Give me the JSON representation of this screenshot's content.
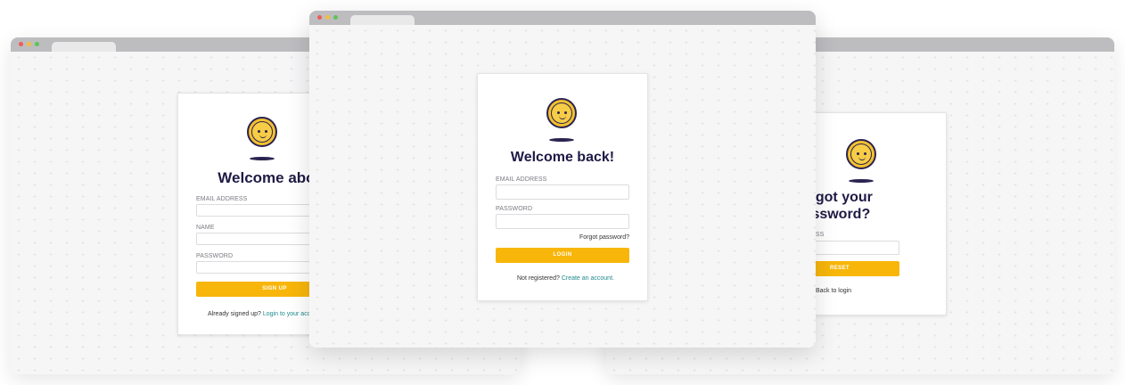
{
  "signup": {
    "title": "Welcome aboard!",
    "email_label": "EMAIL ADDRESS",
    "name_label": "NAME",
    "password_label": "PASSWORD",
    "button": "SIGN UP",
    "footer_text": "Already signed up?",
    "footer_link": "Login to your account."
  },
  "login": {
    "title": "Welcome back!",
    "email_label": "EMAIL ADDRESS",
    "password_label": "PASSWORD",
    "forgot_link": "Forgot password?",
    "button": "LOGIN",
    "footer_text": "Not registered?",
    "footer_link": "Create an account."
  },
  "forgot": {
    "title_line1": "Forgot your",
    "title_line2": "password?",
    "email_label": "EMAIL ADDRESS",
    "button": "RESET",
    "back_link": "Back to login"
  },
  "colors": {
    "accent": "#f8b60a",
    "heading": "#1f1a45",
    "link": "#1f8a8e"
  }
}
